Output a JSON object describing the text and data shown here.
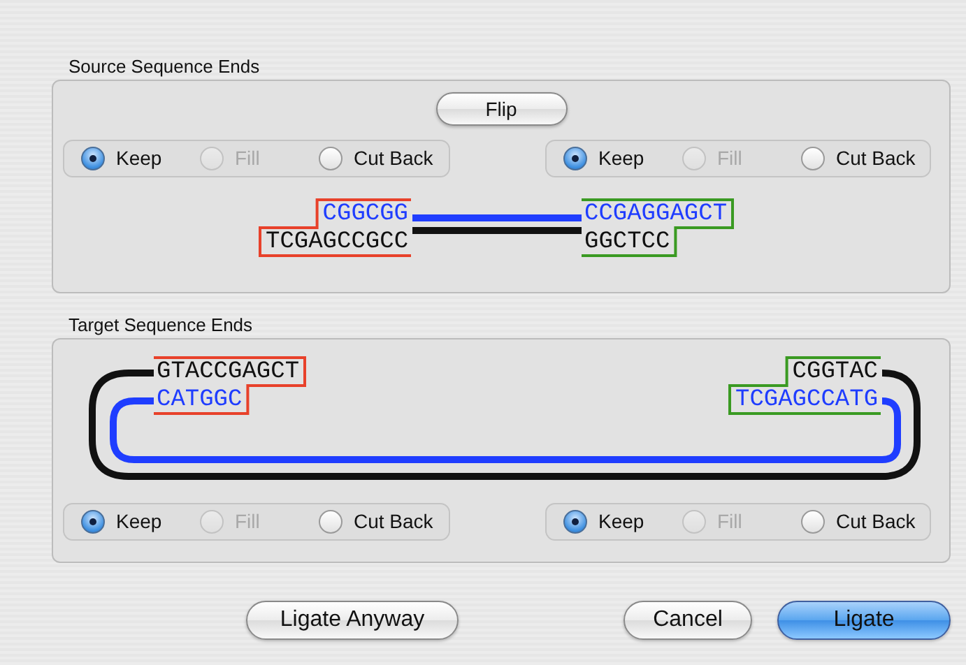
{
  "source": {
    "title": "Source Sequence Ends",
    "flip_button": "Flip",
    "ends": [
      {
        "color": "#e8412a",
        "strands": [
          {
            "text": "CGGCGG",
            "color": "#1f3dff"
          },
          {
            "text": "TCGAGCCGCC",
            "color": "#111111"
          }
        ],
        "options": [
          {
            "label": "Keep",
            "selected": true,
            "disabled": false
          },
          {
            "label": "Fill",
            "selected": false,
            "disabled": true
          },
          {
            "label": "Cut Back",
            "selected": false,
            "disabled": false
          }
        ]
      },
      {
        "color": "#3a9a22",
        "strands": [
          {
            "text": "CCGAGGAGCT",
            "color": "#1f3dff"
          },
          {
            "text": "GGCTCC",
            "color": "#111111"
          }
        ],
        "options": [
          {
            "label": "Keep",
            "selected": true,
            "disabled": false
          },
          {
            "label": "Fill",
            "selected": false,
            "disabled": true
          },
          {
            "label": "Cut Back",
            "selected": false,
            "disabled": false
          }
        ]
      }
    ]
  },
  "target": {
    "title": "Target Sequence Ends",
    "ends": [
      {
        "color": "#e8412a",
        "strands": [
          {
            "text": "GTACCGAGCT",
            "color": "#111111"
          },
          {
            "text": "CATGGC",
            "color": "#1f3dff"
          }
        ],
        "options": [
          {
            "label": "Keep",
            "selected": true,
            "disabled": false
          },
          {
            "label": "Fill",
            "selected": false,
            "disabled": true
          },
          {
            "label": "Cut Back",
            "selected": false,
            "disabled": false
          }
        ]
      },
      {
        "color": "#3a9a22",
        "strands": [
          {
            "text": "CGGTAC",
            "color": "#111111"
          },
          {
            "text": "TCGAGCCATG",
            "color": "#1f3dff"
          }
        ],
        "options": [
          {
            "label": "Keep",
            "selected": true,
            "disabled": false
          },
          {
            "label": "Fill",
            "selected": false,
            "disabled": true
          },
          {
            "label": "Cut Back",
            "selected": false,
            "disabled": false
          }
        ]
      }
    ]
  },
  "buttons": [
    {
      "label": "Ligate Anyway",
      "kind": "normal"
    },
    {
      "label": "Cancel",
      "kind": "normal"
    },
    {
      "label": "Ligate",
      "kind": "default"
    }
  ]
}
